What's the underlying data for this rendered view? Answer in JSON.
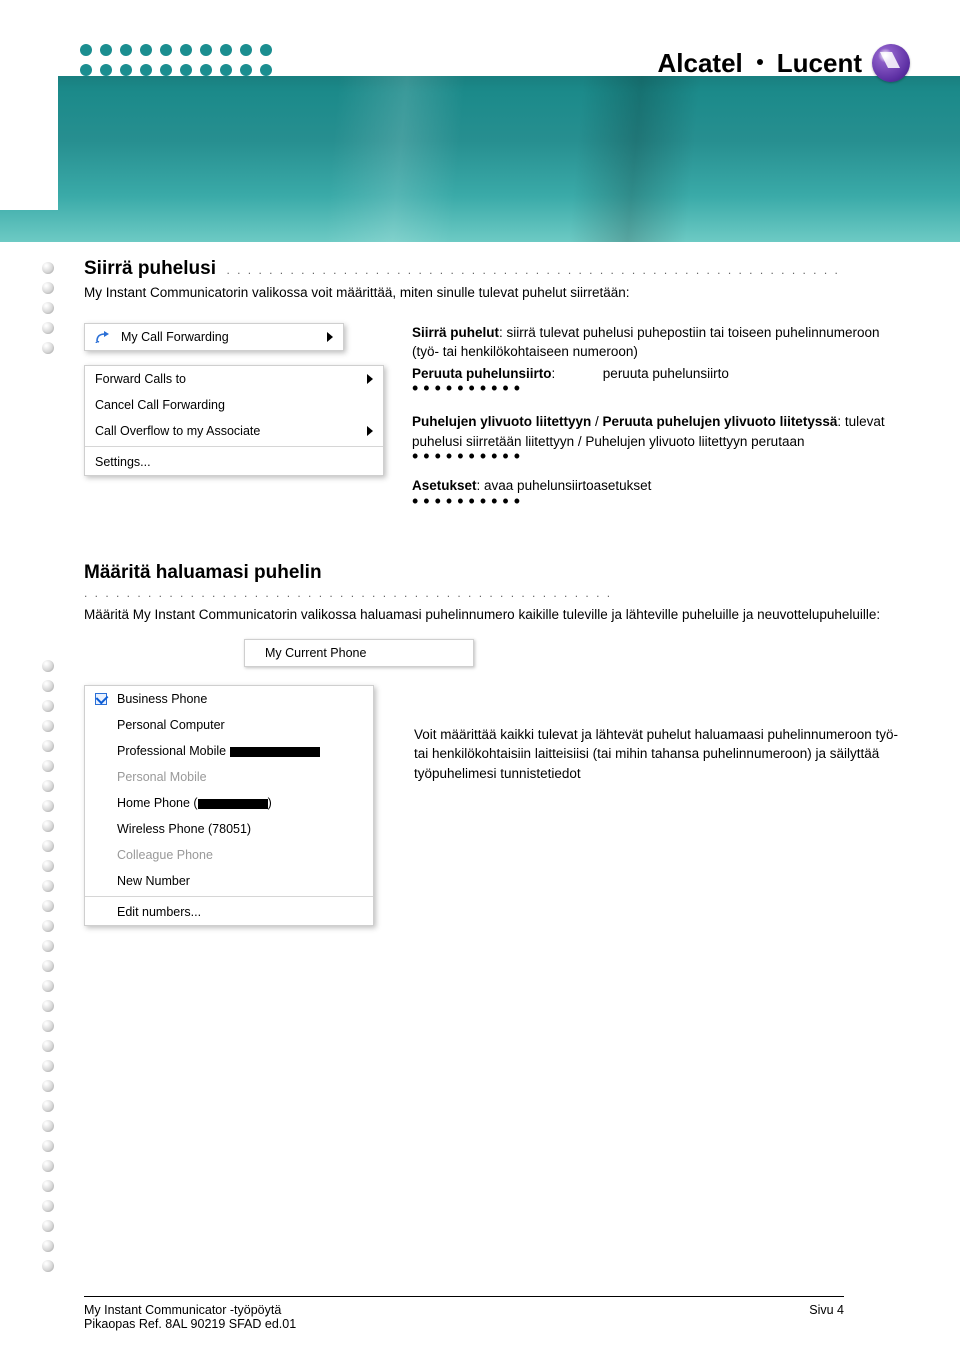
{
  "brand": {
    "name1": "Alcatel",
    "name2": "Lucent"
  },
  "section1": {
    "title": "Siirrä puhelusi",
    "intro": "My Instant Communicatorin valikossa voit määrittää, miten sinulle tulevat puhelut siirretään:",
    "menu_top": {
      "label": "My Call Forwarding"
    },
    "menu": {
      "items": [
        {
          "label": "Forward Calls to",
          "arrow": true
        },
        {
          "label": "Cancel Call Forwarding"
        },
        {
          "label": "Call Overflow to my Associate",
          "arrow": true
        },
        {
          "label": "Settings...",
          "sep_before": true
        }
      ]
    },
    "right": {
      "r1_label": "Siirrä puhelut",
      "r1_text": ": siirrä tulevat puhelusi puhepostiin tai toiseen puhelinnumeroon (työ- tai henkilökohtaiseen numeroon)",
      "r2_label": "Peruuta puhelunsiirto",
      "r2_text": ": ",
      "r2_tail": "peruuta puhelunsiirto",
      "r3_label_a": "Puhelujen ylivuoto liitettyyn",
      "r3_label_b": "Peruuta puhelujen ylivuoto liitetyssä",
      "r3_text": ": tulevat puhelusi siirretään liitettyyn / Puhelujen ylivuoto liitettyyn perutaan",
      "r4_label": "Asetukset",
      "r4_text": ": avaa puhelunsiirtoasetukset"
    }
  },
  "section2": {
    "title": "Määritä haluamasi puhelin",
    "intro": "Määritä My Instant Communicatorin valikossa haluamasi puhelinnumero kaikille tuleville ja lähteville puheluille ja neuvottelupuheluille:",
    "current": {
      "label": "My Current Phone"
    },
    "phones": [
      {
        "label": "Business Phone",
        "checked": true
      },
      {
        "label": "Personal Computer"
      },
      {
        "label": "Professional Mobile",
        "redact": 90
      },
      {
        "label": "Personal Mobile",
        "muted": true
      },
      {
        "label": "Home Phone (",
        "redact": 70,
        "tail": ")"
      },
      {
        "label": "Wireless Phone (78051)"
      },
      {
        "label": "Colleague Phone",
        "muted": true
      },
      {
        "label": "New Number"
      },
      {
        "label": "Edit numbers...",
        "sep_before": true
      }
    ],
    "side_text": "Voit määrittää kaikki tulevat ja lähtevät puhelut haluamaasi puhelinnumeroon työ- tai henkilökohtaisiin laitteisiisi (tai mihin tahansa puhelinnumeroon) ja säilyttää työpuhelimesi tunnistetiedot"
  },
  "footer": {
    "left1": "My Instant Communicator -työpöytä",
    "right1": "Sivu 4",
    "left2": "Pikaopas Ref. 8AL 90219 SFAD ed.01"
  }
}
